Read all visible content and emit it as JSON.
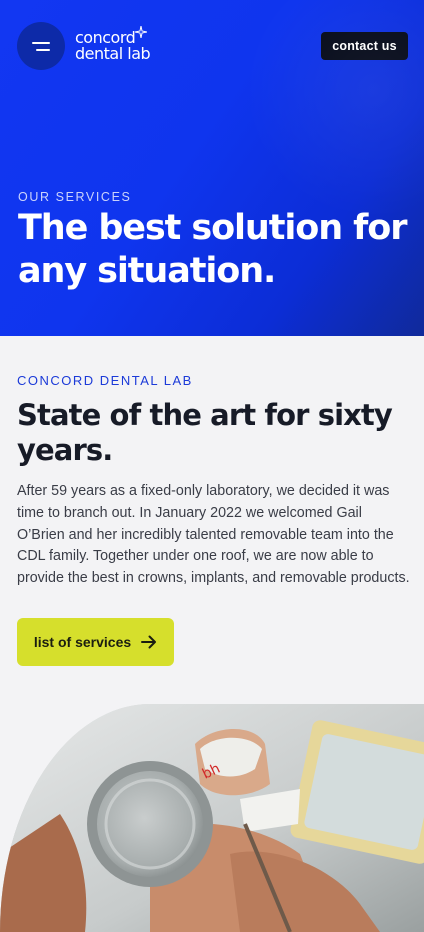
{
  "header": {
    "menu_icon": "hamburger-menu-icon",
    "logo_line1": "concord",
    "logo_line2": "dental lab",
    "logo_spark_icon": "sparkle-icon",
    "contact_label": "contact us"
  },
  "hero": {
    "eyebrow": "OUR SERVICES",
    "title": "The best solution for any situation.",
    "background_color": "#0f35ee"
  },
  "intro": {
    "eyebrow": "CONCORD DENTAL LAB",
    "title": "State of the art for sixty years.",
    "body": "After 59 years as a fixed-only laboratory, we decided it was time to branch out. In January 2022 we welcomed Gail O’Brien and her incredibly talented removable team into the CDL family. Together under one roof, we are now able to provide the best in crowns, implants, and removable products.",
    "button_label": "list of services",
    "button_icon": "arrow-right-icon",
    "accent_color": "#1b3ad8",
    "button_color": "#d6df2c"
  },
  "photo": {
    "description_icon": "dental-lab-photo"
  }
}
